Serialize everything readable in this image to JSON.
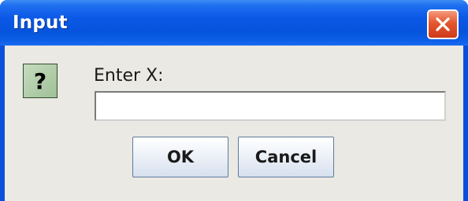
{
  "window": {
    "title": "Input",
    "close_icon": "close-icon"
  },
  "dialog": {
    "icon": "question-icon",
    "icon_glyph": "?",
    "prompt": "Enter X:",
    "input_value": "",
    "ok_label": "OK",
    "cancel_label": "Cancel"
  },
  "colors": {
    "titlebar": "#0654dc",
    "close_button": "#e4572f",
    "client_background": "#ebe9e3",
    "question_icon_bg": "#b3cfab"
  }
}
